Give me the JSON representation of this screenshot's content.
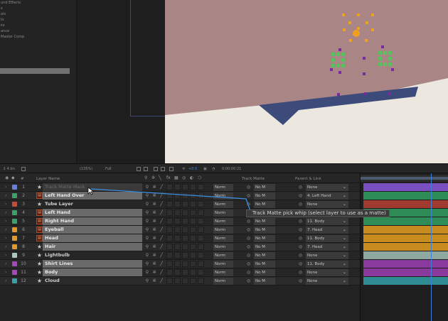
{
  "left_panel": {
    "items": [
      "und Effects",
      "",
      "s",
      "ols",
      "ts",
      "ks",
      "",
      "",
      "",
      "",
      "ance",
      "Master Comp",
      ""
    ],
    "selected_index": 12
  },
  "viewer_bar": {
    "zoom": "(135%)",
    "quality": "Full",
    "fps": "+0.0",
    "timecode": "0:00:00:21"
  },
  "timeline": {
    "headers": {
      "num": "#",
      "layer_name": "Layer Name",
      "track_matte": "Track Matte",
      "parent_link": "Parent & Link"
    },
    "layers": [
      {
        "num": "1",
        "label_color": "#6a7ee0",
        "type": "star",
        "name": "Track Matte Mask",
        "style": "ghost",
        "mode": "Norm",
        "matte": "No M",
        "parent": "None",
        "bar_color": "#7a4fc0"
      },
      {
        "num": "2",
        "label_color": "#3aa36a",
        "type": "precomp",
        "name": "Left Hand Over",
        "style": "sel",
        "mode": "Norm",
        "matte": "No M",
        "parent": "4. Left Hand",
        "bar_color": "#2e8c56"
      },
      {
        "num": "3",
        "label_color": "#c94a3c",
        "type": "star",
        "name": "Tube Layer",
        "style": "plain",
        "mode": "Norm",
        "matte": "No M",
        "parent": "None",
        "bar_color": "#a03a2e"
      },
      {
        "num": "4",
        "label_color": "#3aa36a",
        "type": "precomp",
        "name": "Left Hand",
        "style": "sel",
        "mode": "Norm",
        "matte": "No M",
        "parent": "11. Body",
        "bar_color": "#2e8c56"
      },
      {
        "num": "5",
        "label_color": "#3aa36a",
        "type": "precomp",
        "name": "Right Hand",
        "style": "sel",
        "mode": "Norm",
        "matte": "No M",
        "parent": "11. Body",
        "bar_color": "#2e8c56"
      },
      {
        "num": "6",
        "label_color": "#e09a2a",
        "type": "precomp",
        "name": "Eyeball",
        "style": "sel",
        "mode": "Norm",
        "matte": "No M",
        "parent": "7. Head",
        "bar_color": "#c88b1d"
      },
      {
        "num": "7",
        "label_color": "#e09a2a",
        "type": "precomp",
        "name": "Head",
        "style": "sel",
        "mode": "Norm",
        "matte": "No M",
        "parent": "11. Body",
        "bar_color": "#c88b1d"
      },
      {
        "num": "8",
        "label_color": "#e09a2a",
        "type": "star",
        "name": "Hair",
        "style": "sel",
        "mode": "Norm",
        "matte": "No M",
        "parent": "7. Head",
        "bar_color": "#c88b1d"
      },
      {
        "num": "9",
        "label_color": "#a8c8c0",
        "type": "star",
        "name": "Lightbulb",
        "style": "plain",
        "mode": "Norm",
        "matte": "No M",
        "parent": "None",
        "bar_color": "#8fa8a2"
      },
      {
        "num": "10",
        "label_color": "#a648b8",
        "type": "star",
        "name": "Shirt Lines",
        "style": "sel",
        "mode": "Norm",
        "matte": "No M",
        "parent": "11. Body",
        "bar_color": "#8a3a9c"
      },
      {
        "num": "11",
        "label_color": "#a648b8",
        "type": "star",
        "name": "Body",
        "style": "sel",
        "mode": "Norm",
        "matte": "No M",
        "parent": "None",
        "bar_color": "#8a3a9c"
      },
      {
        "num": "12",
        "label_color": "#3aa0a8",
        "type": "star",
        "name": "Cloud",
        "style": "plain",
        "mode": "Norm",
        "matte": "No M",
        "parent": "None",
        "bar_color": "#2f8c92"
      }
    ],
    "tooltip": "Track Matte pick whip (select layer to use as a matte)"
  },
  "colors": {
    "accent_blue": "#3b7fd6",
    "viewer_bg": "#ece7df",
    "canvas_pink": "#a98585",
    "shape_navy": "#3d4b7a"
  }
}
